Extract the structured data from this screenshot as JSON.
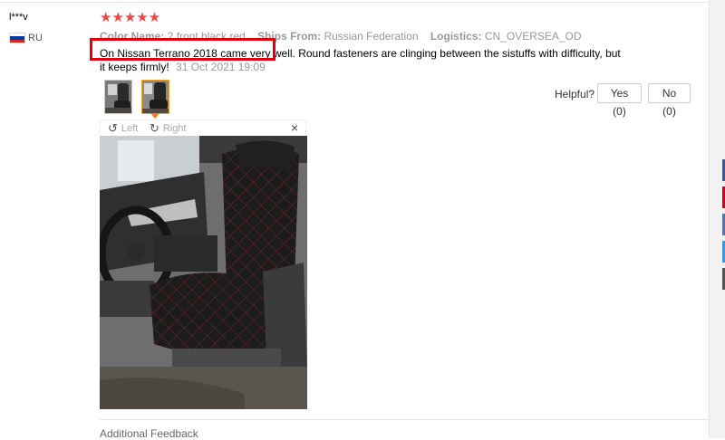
{
  "reviewer": {
    "name": "l***v",
    "country": "RU",
    "flag_colors": [
      "#ffffff",
      "#0039a6",
      "#d52b1e"
    ]
  },
  "rating": {
    "stars": 5,
    "display": "★★★★★",
    "color": "#f04645"
  },
  "attributes": {
    "color_label": "Color Name:",
    "color_value": "2 front black red",
    "ships_label": "Ships From:",
    "ships_value": "Russian Federation",
    "logistics_label": "Logistics:",
    "logistics_value": "CN_OVERSEA_OD"
  },
  "review": {
    "text": "On Nissan Terrano 2018 came very well. Round fasteners are clinging between the sistuffs with difficulty, but it keeps firmly!",
    "date": "31 Oct 2021 19:09"
  },
  "helpful": {
    "label": "Helpful?",
    "yes": "Yes (0)",
    "no": "No (0)"
  },
  "viewer": {
    "left": "Left",
    "right": "Right",
    "close": "×"
  },
  "footer": {
    "additional": "Additional Feedback"
  },
  "colors": {
    "highlight": "#e0000f",
    "selected_thumb": "#f5a623"
  }
}
